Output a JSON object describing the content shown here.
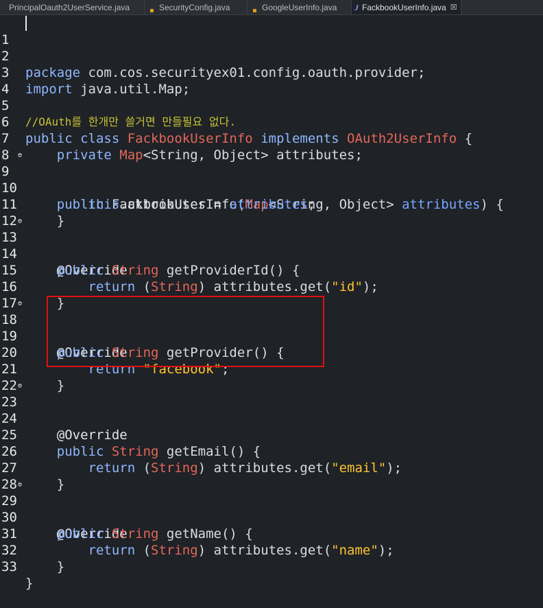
{
  "tabs": [
    {
      "label": "PrincipalOauth2UserService.java",
      "icon": "java-file-icon",
      "active": false
    },
    {
      "label": "SecurityConfig.java",
      "icon": "java-file-modified-icon",
      "active": false
    },
    {
      "label": "GoogleUserInfo.java",
      "icon": "java-file-icon",
      "active": false
    },
    {
      "label": "FackbookUserInfo.java",
      "icon": "java-class-icon",
      "active": true,
      "close": "☒"
    }
  ],
  "code": {
    "line_numbers": [
      "1",
      "2",
      "3",
      "4",
      "5",
      "6",
      "7",
      "8",
      "9",
      "10",
      "11",
      "12",
      "13",
      "14",
      "15",
      "16",
      "17",
      "18",
      "19",
      "20",
      "21",
      "22",
      "23",
      "24",
      "25",
      "26",
      "27",
      "28",
      "29",
      "30",
      "31",
      "32",
      "33"
    ],
    "lines": {
      "l1_a": "package",
      "l1_b": " com.cos.securityex01.config.oauth.provider;",
      "l3_a": "import",
      "l3_b": " java.util.Map;",
      "l5_a": "//OAuth를 한개만 쓸거면 만들필요 없다.",
      "l6_a": "public class ",
      "l6_b": "FackbookUserInfo",
      "l6_c": " implements ",
      "l6_d": "OAuth2UserInfo",
      "l6_e": " {",
      "l7_a": "    private ",
      "l7_b": "Map",
      "l7_c": "<String, Object> attributes;",
      "l9_a": "    public ",
      "l9_b": "FackbookUserInfo(",
      "l9_c": "Map",
      "l9_d": "<String, Object> ",
      "l9_e": "attributes",
      "l9_f": ") {",
      "l10_a": "        this",
      "l10_b": ".attributes = ",
      "l10_c": "attributes",
      "l10_d": ";",
      "l11_a": "    }",
      "l13_a": "    @Override",
      "l14_a": "    public ",
      "l14_b": "String",
      "l14_c": " getProviderId() {",
      "l15_a": "        return ",
      "l15_b": "(",
      "l15_c": "String",
      "l15_d": ") attributes.get(",
      "l15_e": "\"id\"",
      "l15_f": ");",
      "l16_a": "    }",
      "l18_a": "    @Override",
      "l19_a": "    public ",
      "l19_b": "String",
      "l19_c": " getProvider() {",
      "l20_a": "        return ",
      "l20_b": "\"facebook\"",
      "l20_c": ";",
      "l21_a": "    }",
      "l23_a": "    @Override",
      "l25_a": "    public ",
      "l25_b": "String",
      "l25_c": " getEmail() {",
      "l26_a": "        return ",
      "l26_b": "(",
      "l26_c": "String",
      "l26_d": ") attributes.get(",
      "l26_e": "\"email\"",
      "l26_f": ");",
      "l27_a": "    }",
      "l29_a": "    @Override",
      "l30_a": "    public ",
      "l30_b": "String",
      "l30_c": " getName() {",
      "l31_a": "        return ",
      "l31_b": "(",
      "l31_c": "String",
      "l31_d": ") attributes.get(",
      "l31_e": "\"name\"",
      "l31_f": ");",
      "l32_a": "    }",
      "l33_a": "}"
    }
  },
  "colors": {
    "background": "#1f2226",
    "keyword": "#8fb7ff",
    "type": "#e3675b",
    "string": "#ffc431",
    "comment": "#c7c236",
    "field": "#7aa7ff",
    "highlight_box": "#e01010"
  }
}
